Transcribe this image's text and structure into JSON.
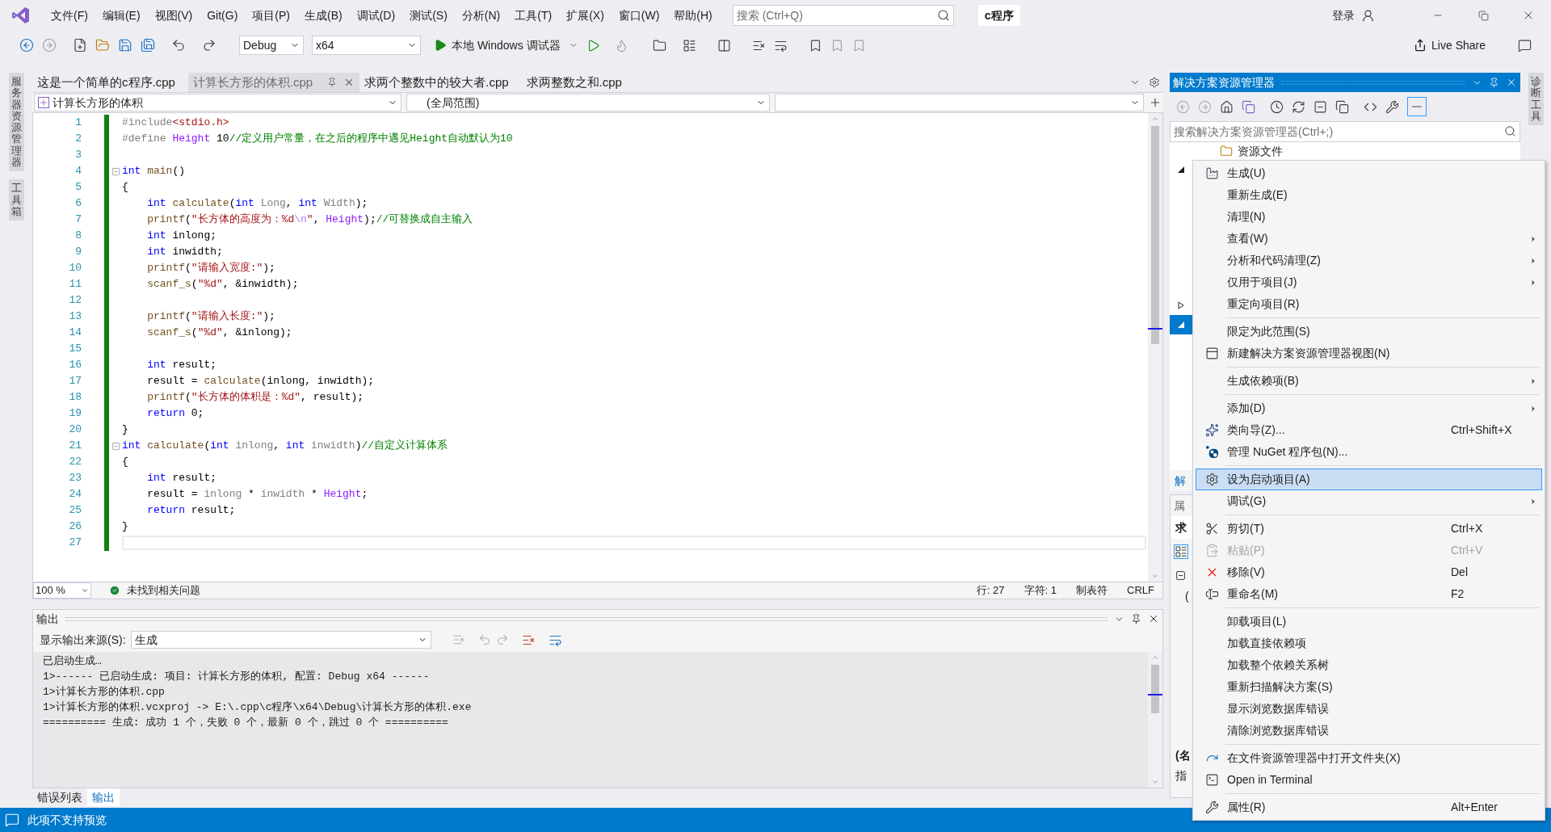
{
  "title_bar": {
    "menus": [
      "文件(F)",
      "编辑(E)",
      "视图(V)",
      "Git(G)",
      "项目(P)",
      "生成(B)",
      "调试(D)",
      "测试(S)",
      "分析(N)",
      "工具(T)",
      "扩展(X)",
      "窗口(W)",
      "帮助(H)"
    ],
    "search": {
      "placeholder": "搜索 (Ctrl+Q)"
    },
    "solution_name": "c程序",
    "sign_in": "登录"
  },
  "toolbar": {
    "configuration": "Debug",
    "platform": "x64",
    "debugger": "本地 Windows 调试器",
    "live_share": "Live Share"
  },
  "left_side_tabs": [
    "服务器资源管理器",
    "工具箱"
  ],
  "right_side_tabs": [
    "诊断工具"
  ],
  "editor": {
    "tabs": [
      {
        "label": "这是一个简单的c程序.cpp",
        "selected": false
      },
      {
        "label": "计算长方形的体积.cpp",
        "selected": true
      },
      {
        "label": "求两个整数中的较大者.cpp",
        "selected": false
      },
      {
        "label": "求两整数之和.cpp",
        "selected": false
      }
    ],
    "nav": {
      "project": "计算长方形的体积",
      "scope": "(全局范围)"
    },
    "lines": [
      {
        "number": "1",
        "fold": false,
        "current": false,
        "tokens": [
          {
            "kind": "pp",
            "text": "#include"
          },
          {
            "kind": "str",
            "text": "<stdio.h>"
          }
        ]
      },
      {
        "number": "2",
        "fold": false,
        "current": false,
        "tokens": [
          {
            "kind": "pp",
            "text": "#define"
          },
          {
            "kind": "mac",
            "text": " Height"
          },
          {
            "kind": "pl",
            "text": " 10"
          },
          {
            "kind": "cm",
            "text": "//定义用户常量，在之后的程序中遇见Height自动默认为10"
          }
        ]
      },
      {
        "number": "3",
        "fold": false,
        "current": false
      },
      {
        "number": "4",
        "fold": true,
        "current": false,
        "tokens": [
          {
            "kind": "kw",
            "text": "int"
          },
          {
            "kind": "fn",
            "text": " main"
          },
          {
            "kind": "pl",
            "text": "()"
          }
        ]
      },
      {
        "number": "5",
        "fold": false,
        "current": false,
        "tokens": [
          {
            "kind": "pl",
            "text": "{"
          }
        ]
      },
      {
        "number": "6",
        "fold": false,
        "current": false,
        "tokens": [
          {
            "kind": "kw",
            "text": "    int"
          },
          {
            "kind": "fn",
            "text": " calculate"
          },
          {
            "kind": "pl",
            "text": "("
          },
          {
            "kind": "kw",
            "text": "int"
          },
          {
            "kind": "prm",
            "text": " Long"
          },
          {
            "kind": "pl",
            "text": ", "
          },
          {
            "kind": "kw",
            "text": "int"
          },
          {
            "kind": "prm",
            "text": " Width"
          },
          {
            "kind": "pl",
            "text": ");"
          }
        ]
      },
      {
        "number": "7",
        "fold": false,
        "current": false,
        "tokens": [
          {
            "kind": "fn",
            "text": "    printf"
          },
          {
            "kind": "pl",
            "text": "("
          },
          {
            "kind": "str",
            "text": "\"长方体的高度为：%d"
          },
          {
            "kind": "esc",
            "text": "\\n"
          },
          {
            "kind": "str",
            "text": "\""
          },
          {
            "kind": "pl",
            "text": ", "
          },
          {
            "kind": "mac",
            "text": "Height"
          },
          {
            "kind": "pl",
            "text": ");"
          },
          {
            "kind": "cm",
            "text": "//可替换成自主输入"
          }
        ]
      },
      {
        "number": "8",
        "fold": false,
        "current": false,
        "tokens": [
          {
            "kind": "kw",
            "text": "    int"
          },
          {
            "kind": "pl",
            "text": " inlong;"
          }
        ]
      },
      {
        "number": "9",
        "fold": false,
        "current": false,
        "tokens": [
          {
            "kind": "kw",
            "text": "    int"
          },
          {
            "kind": "pl",
            "text": " inwidth;"
          }
        ]
      },
      {
        "number": "10",
        "fold": false,
        "current": false,
        "tokens": [
          {
            "kind": "fn",
            "text": "    printf"
          },
          {
            "kind": "pl",
            "text": "("
          },
          {
            "kind": "str",
            "text": "\"请输入宽度:\""
          },
          {
            "kind": "pl",
            "text": ");"
          }
        ]
      },
      {
        "number": "11",
        "fold": false,
        "current": false,
        "tokens": [
          {
            "kind": "fn",
            "text": "    scanf_s"
          },
          {
            "kind": "pl",
            "text": "("
          },
          {
            "kind": "str",
            "text": "\"%d\""
          },
          {
            "kind": "pl",
            "text": ", &inwidth);"
          }
        ]
      },
      {
        "number": "12",
        "fold": false,
        "current": false
      },
      {
        "number": "13",
        "fold": false,
        "current": false,
        "tokens": [
          {
            "kind": "fn",
            "text": "    printf"
          },
          {
            "kind": "pl",
            "text": "("
          },
          {
            "kind": "str",
            "text": "\"请输入长度:\""
          },
          {
            "kind": "pl",
            "text": ");"
          }
        ]
      },
      {
        "number": "14",
        "fold": false,
        "current": false,
        "tokens": [
          {
            "kind": "fn",
            "text": "    scanf_s"
          },
          {
            "kind": "pl",
            "text": "("
          },
          {
            "kind": "str",
            "text": "\"%d\""
          },
          {
            "kind": "pl",
            "text": ", &inlong);"
          }
        ]
      },
      {
        "number": "15",
        "fold": false,
        "current": false
      },
      {
        "number": "16",
        "fold": false,
        "current": false,
        "tokens": [
          {
            "kind": "kw",
            "text": "    int"
          },
          {
            "kind": "pl",
            "text": " result;"
          }
        ]
      },
      {
        "number": "17",
        "fold": false,
        "current": false,
        "tokens": [
          {
            "kind": "pl",
            "text": "    result = "
          },
          {
            "kind": "fn",
            "text": "calculate"
          },
          {
            "kind": "pl",
            "text": "(inlong, inwidth);"
          }
        ]
      },
      {
        "number": "18",
        "fold": false,
        "current": false,
        "tokens": [
          {
            "kind": "fn",
            "text": "    printf"
          },
          {
            "kind": "pl",
            "text": "("
          },
          {
            "kind": "str",
            "text": "\"长方体的体积是：%d\""
          },
          {
            "kind": "pl",
            "text": ", result);"
          }
        ]
      },
      {
        "number": "19",
        "fold": false,
        "current": false,
        "tokens": [
          {
            "kind": "kw",
            "text": "    return"
          },
          {
            "kind": "pl",
            "text": " 0;"
          }
        ]
      },
      {
        "number": "20",
        "fold": false,
        "current": false,
        "tokens": [
          {
            "kind": "pl",
            "text": "}"
          }
        ]
      },
      {
        "number": "21",
        "fold": true,
        "current": false,
        "tokens": [
          {
            "kind": "kw",
            "text": "int"
          },
          {
            "kind": "fn",
            "text": " calculate"
          },
          {
            "kind": "pl",
            "text": "("
          },
          {
            "kind": "kw",
            "text": "int"
          },
          {
            "kind": "prm",
            "text": " inlong"
          },
          {
            "kind": "pl",
            "text": ", "
          },
          {
            "kind": "kw",
            "text": "int"
          },
          {
            "kind": "prm",
            "text": " inwidth"
          },
          {
            "kind": "pl",
            "text": ")"
          },
          {
            "kind": "cm",
            "text": "//自定义计算体系"
          }
        ]
      },
      {
        "number": "22",
        "fold": false,
        "current": false,
        "tokens": [
          {
            "kind": "pl",
            "text": "{"
          }
        ]
      },
      {
        "number": "23",
        "fold": false,
        "current": false,
        "tokens": [
          {
            "kind": "kw",
            "text": "    int"
          },
          {
            "kind": "pl",
            "text": " result;"
          }
        ]
      },
      {
        "number": "24",
        "fold": false,
        "current": false,
        "tokens": [
          {
            "kind": "pl",
            "text": "    result = "
          },
          {
            "kind": "prm",
            "text": "inlong"
          },
          {
            "kind": "pl",
            "text": " * "
          },
          {
            "kind": "prm",
            "text": "inwidth"
          },
          {
            "kind": "pl",
            "text": " * "
          },
          {
            "kind": "mac",
            "text": "Height"
          },
          {
            "kind": "pl",
            "text": ";"
          }
        ]
      },
      {
        "number": "25",
        "fold": false,
        "current": false,
        "tokens": [
          {
            "kind": "kw",
            "text": "    return"
          },
          {
            "kind": "pl",
            "text": " result;"
          }
        ]
      },
      {
        "number": "26",
        "fold": false,
        "current": false,
        "tokens": [
          {
            "kind": "pl",
            "text": "}"
          }
        ]
      },
      {
        "number": "27",
        "fold": false,
        "current": true
      }
    ],
    "status": {
      "zoom": "100 %",
      "issues": "未找到相关问题",
      "line": "行: 27",
      "char": "字符: 1",
      "indent": "制表符",
      "eol": "CRLF"
    }
  },
  "output": {
    "title": "输出",
    "source_label": "显示输出来源(S):",
    "source": "生成",
    "lines": [
      "已启动生成…",
      "1>------ 已启动生成: 项目: 计算长方形的体积, 配置: Debug x64 ------",
      "1>计算长方形的体积.cpp",
      "1>计算长方形的体积.vcxproj -> E:\\.cpp\\c程序\\x64\\Debug\\计算长方形的体积.exe",
      "========== 生成: 成功 1 个，失败 0 个，最新 0 个，跳过 0 个 =========="
    ]
  },
  "bottom_tabs": [
    {
      "label": "错误列表",
      "selected": false
    },
    {
      "label": "输出",
      "selected": true
    }
  ],
  "solution_explorer": {
    "title": "解决方案资源管理器",
    "search": {
      "placeholder": "搜索解决方案资源管理器(Ctrl+;)"
    },
    "tree_item": "资源文件",
    "tree_toggles": [
      {
        "expanded": true,
        "selected": false
      },
      {
        "expanded": false,
        "selected": false
      },
      {
        "expanded": true,
        "selected": true
      }
    ],
    "tab_link": "解",
    "properties": {
      "title": "属",
      "object": "求",
      "rows": [
        "("
      ],
      "description": [
        "(名",
        "指"
      ]
    }
  },
  "context_menu": {
    "items": [
      {
        "kind": "build",
        "label": "生成(U)",
        "submenu": false,
        "disabled": false,
        "selected": false
      },
      {
        "kind": "plain",
        "label": "重新生成(E)",
        "submenu": false,
        "disabled": false,
        "selected": false
      },
      {
        "kind": "plain",
        "label": "清理(N)",
        "submenu": false,
        "disabled": false,
        "selected": false
      },
      {
        "kind": "plain",
        "label": "查看(W)",
        "submenu": true,
        "disabled": false,
        "selected": false
      },
      {
        "kind": "plain",
        "label": "分析和代码清理(Z)",
        "submenu": true,
        "disabled": false,
        "selected": false
      },
      {
        "kind": "plain",
        "label": "仅用于项目(J)",
        "submenu": true,
        "disabled": false,
        "selected": false
      },
      {
        "kind": "plain",
        "label": "重定向项目(R)",
        "submenu": false,
        "disabled": false,
        "selected": false
      },
      {
        "kind": "separator"
      },
      {
        "kind": "plain",
        "label": "限定为此范围(S)",
        "submenu": false,
        "disabled": false,
        "selected": false
      },
      {
        "kind": "view",
        "label": "新建解决方案资源管理器视图(N)",
        "submenu": false,
        "disabled": false,
        "selected": false
      },
      {
        "kind": "separator"
      },
      {
        "kind": "plain",
        "label": "生成依赖项(B)",
        "submenu": true,
        "disabled": false,
        "selected": false
      },
      {
        "kind": "separator"
      },
      {
        "kind": "plain",
        "label": "添加(D)",
        "submenu": true,
        "disabled": false,
        "selected": false
      },
      {
        "kind": "wizard",
        "label": "类向导(Z)...",
        "shortcut": "Ctrl+Shift+X",
        "submenu": false,
        "disabled": false,
        "selected": false
      },
      {
        "kind": "nuget",
        "label": "管理 NuGet 程序包(N)...",
        "submenu": false,
        "disabled": false,
        "selected": false
      },
      {
        "kind": "separator"
      },
      {
        "kind": "gear",
        "label": "设为启动项目(A)",
        "submenu": false,
        "disabled": false,
        "selected": true
      },
      {
        "kind": "plain",
        "label": "调试(G)",
        "submenu": true,
        "disabled": false,
        "selected": false
      },
      {
        "kind": "separator"
      },
      {
        "kind": "cut",
        "label": "剪切(T)",
        "shortcut": "Ctrl+X",
        "submenu": false,
        "disabled": false,
        "selected": false
      },
      {
        "kind": "paste",
        "label": "粘贴(P)",
        "shortcut": "Ctrl+V",
        "submenu": false,
        "disabled": true,
        "selected": false
      },
      {
        "kind": "remove",
        "label": "移除(V)",
        "shortcut": "Del",
        "submenu": false,
        "disabled": false,
        "selected": false
      },
      {
        "kind": "rename",
        "label": "重命名(M)",
        "shortcut": "F2",
        "submenu": false,
        "disabled": false,
        "selected": false
      },
      {
        "kind": "separator"
      },
      {
        "kind": "plain",
        "label": "卸载项目(L)",
        "submenu": false,
        "disabled": false,
        "selected": false
      },
      {
        "kind": "plain",
        "label": "加载直接依赖项",
        "submenu": false,
        "disabled": false,
        "selected": false
      },
      {
        "kind": "plain",
        "label": "加载整个依赖关系树",
        "submenu": false,
        "disabled": false,
        "selected": false
      },
      {
        "kind": "plain",
        "label": "重新扫描解决方案(S)",
        "submenu": false,
        "disabled": false,
        "selected": false
      },
      {
        "kind": "plain",
        "label": "显示浏览数据库错误",
        "submenu": false,
        "disabled": false,
        "selected": false
      },
      {
        "kind": "plain",
        "label": "清除浏览数据库错误",
        "submenu": false,
        "disabled": false,
        "selected": false
      },
      {
        "kind": "separator"
      },
      {
        "kind": "folder",
        "label": "在文件资源管理器中打开文件夹(X)",
        "submenu": false,
        "disabled": false,
        "selected": false
      },
      {
        "kind": "terminal",
        "label": "Open in Terminal",
        "submenu": false,
        "disabled": false,
        "selected": false
      },
      {
        "kind": "separator"
      },
      {
        "kind": "wrench",
        "label": "属性(R)",
        "shortcut": "Alt+Enter",
        "submenu": false,
        "disabled": false,
        "selected": false
      }
    ]
  },
  "status_bar": {
    "text": "此项不支持预览"
  }
}
